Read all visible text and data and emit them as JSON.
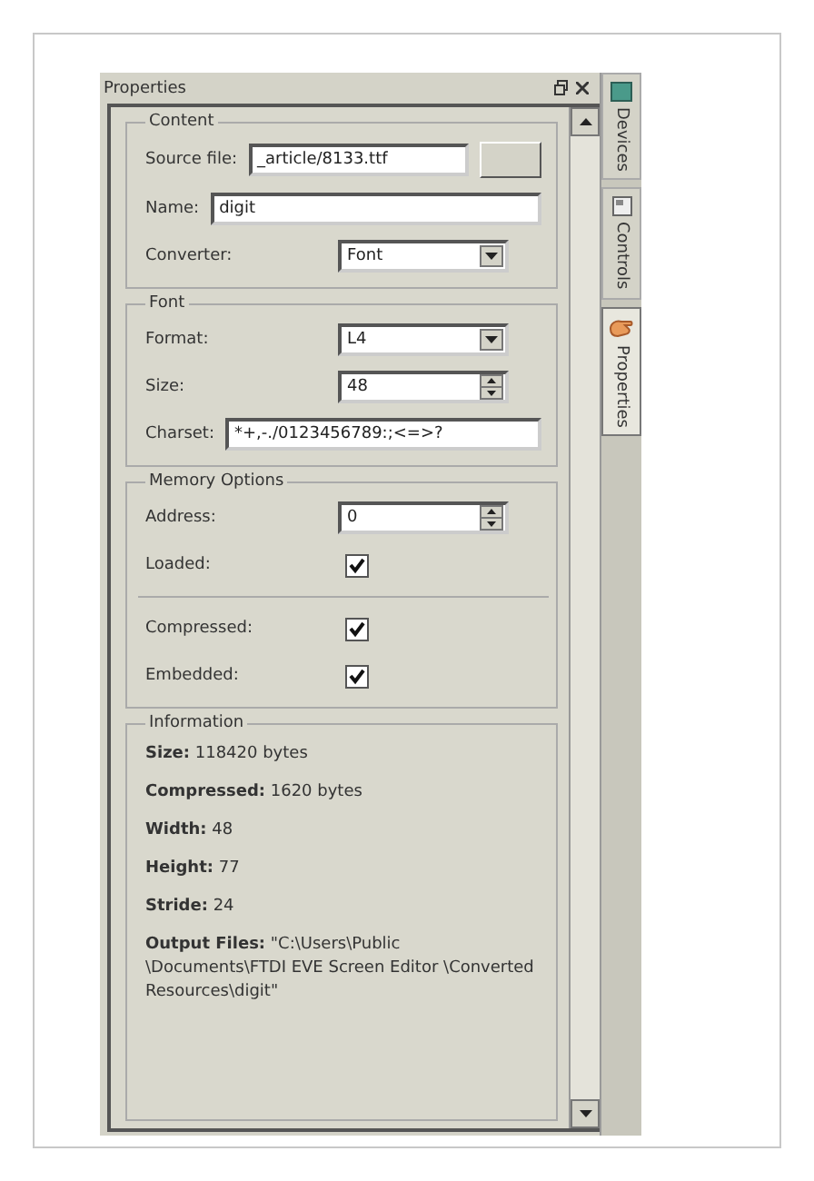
{
  "panel": {
    "title": "Properties"
  },
  "side_tabs": [
    {
      "label": "Devices",
      "selected": false
    },
    {
      "label": "Controls",
      "selected": false
    },
    {
      "label": "Properties",
      "selected": true
    }
  ],
  "groups": [
    {
      "title": "Content",
      "rows": [
        {
          "kind": "file",
          "label": "Source file:",
          "value": "_article/8133.ttf"
        },
        {
          "kind": "text",
          "label": "Name:",
          "value": "digit"
        },
        {
          "kind": "select",
          "label": "Converter:",
          "value": "Font"
        }
      ]
    },
    {
      "title": "Font",
      "rows": [
        {
          "kind": "select",
          "label": "Format:",
          "value": "L4"
        },
        {
          "kind": "spin",
          "label": "Size:",
          "value": "48"
        },
        {
          "kind": "text",
          "label": "Charset:",
          "value": "*+,-./0123456789:;<=>?"
        }
      ]
    },
    {
      "title": "Memory Options",
      "rows": [
        {
          "kind": "spin",
          "label": "Address:",
          "value": "0"
        },
        {
          "kind": "check",
          "label": "Loaded:",
          "checked": true
        },
        {
          "kind": "divider"
        },
        {
          "kind": "check",
          "label": "Compressed:",
          "checked": true
        },
        {
          "kind": "check",
          "label": "Embedded:",
          "checked": true
        }
      ]
    }
  ],
  "information": {
    "title": "Information",
    "lines": [
      "**Size:** 118420 bytes",
      "**Compressed:** 1620 bytes",
      "**Width:** 48",
      "**Height:** 77",
      "**Stride:** 24",
      "**Output Files:** \"C:\\Users\\Public \\Documents\\FTDI EVE Screen Editor \\Converted Resources\\digit\""
    ]
  }
}
